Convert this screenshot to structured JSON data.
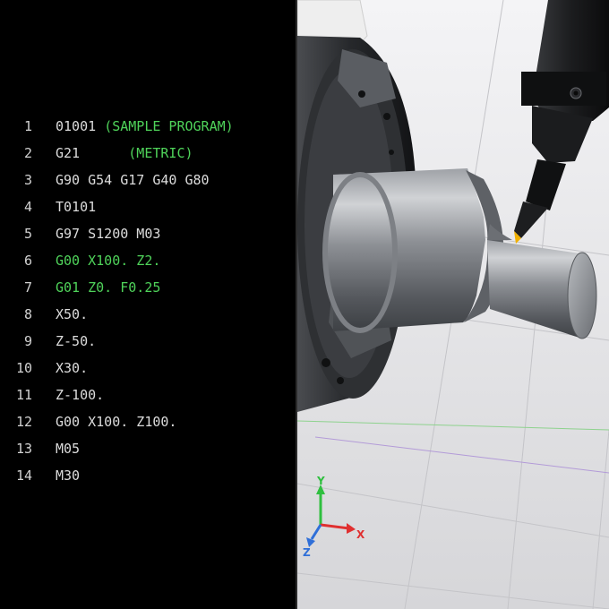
{
  "editor": {
    "lines": [
      {
        "num": "1",
        "code": "01001",
        "comment": "(SAMPLE PROGRAM)",
        "highlight": false
      },
      {
        "num": "2",
        "code": "G21     ",
        "comment": "(METRIC)",
        "highlight": false
      },
      {
        "num": "3",
        "code": "G90 G54 G17 G40 G80",
        "comment": "",
        "highlight": false
      },
      {
        "num": "4",
        "code": "T0101",
        "comment": "",
        "highlight": false
      },
      {
        "num": "5",
        "code": "G97 S1200 M03",
        "comment": "",
        "highlight": false
      },
      {
        "num": "6",
        "code": "G00 X100. Z2.",
        "comment": "",
        "highlight": true
      },
      {
        "num": "7",
        "code": "G01 Z0. F0.25",
        "comment": "",
        "highlight": true
      },
      {
        "num": "8",
        "code": "X50.",
        "comment": "",
        "highlight": false
      },
      {
        "num": "9",
        "code": "Z-50.",
        "comment": "",
        "highlight": false
      },
      {
        "num": "10",
        "code": "X30.",
        "comment": "",
        "highlight": false
      },
      {
        "num": "11",
        "code": "Z-100.",
        "comment": "",
        "highlight": false
      },
      {
        "num": "12",
        "code": "G00 X100. Z100.",
        "comment": "",
        "highlight": false
      },
      {
        "num": "13",
        "code": "M05",
        "comment": "",
        "highlight": false
      },
      {
        "num": "14",
        "code": "M30",
        "comment": "",
        "highlight": false
      }
    ]
  },
  "viewport": {
    "axes": {
      "x_label": "X",
      "y_label": "Y",
      "z_label": "Z"
    },
    "colors": {
      "x_axis": "#e03030",
      "y_axis": "#2fbf3f",
      "z_axis": "#2f6fd8",
      "comment_text": "#4fd35a",
      "code_text": "#dcdcdc",
      "background": "#000000"
    }
  }
}
